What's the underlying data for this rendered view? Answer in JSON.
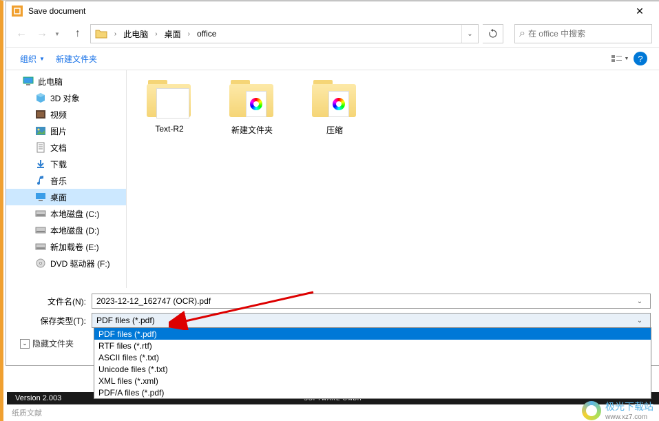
{
  "titlebar": {
    "title": "Save document"
  },
  "nav": {
    "path_segments": [
      "此电脑",
      "桌面",
      "office"
    ],
    "search_placeholder": "在 office 中搜索"
  },
  "toolbar": {
    "organize": "组织",
    "new_folder": "新建文件夹"
  },
  "sidebar": {
    "root": "此电脑",
    "items": [
      {
        "label": "3D 对象",
        "icon": "3d"
      },
      {
        "label": "视频",
        "icon": "video"
      },
      {
        "label": "图片",
        "icon": "pictures"
      },
      {
        "label": "文档",
        "icon": "docs"
      },
      {
        "label": "下载",
        "icon": "downloads"
      },
      {
        "label": "音乐",
        "icon": "music"
      },
      {
        "label": "桌面",
        "icon": "desktop",
        "selected": true
      },
      {
        "label": "本地磁盘 (C:)",
        "icon": "disk"
      },
      {
        "label": "本地磁盘 (D:)",
        "icon": "disk"
      },
      {
        "label": "新加载卷 (E:)",
        "icon": "disk"
      },
      {
        "label": "DVD 驱动器 (F:)",
        "icon": "dvd"
      }
    ]
  },
  "files": [
    {
      "label": "Text-R2",
      "type": "plain"
    },
    {
      "label": "新建文件夹",
      "type": "color"
    },
    {
      "label": "压缩",
      "type": "color"
    }
  ],
  "filename": {
    "label": "文件名(N):",
    "value": "2023-12-12_162747 (OCR).pdf"
  },
  "filetype": {
    "label": "保存类型(T):",
    "value": "PDF files (*.pdf)",
    "options": [
      "PDF files (*.pdf)",
      "RTF files (*.rtf)",
      "ASCII files (*.txt)",
      "Unicode files (*.txt)",
      "XML files (*.xml)",
      "PDF/A files (*.pdf)"
    ]
  },
  "hide_folders": "隐藏文件夹",
  "status": {
    "version": "Version 2.003",
    "center": "SOFTWARE GMBH"
  },
  "watermark": {
    "text": "极光下载站",
    "url": "www.xz7.com"
  },
  "bottom_text": "纸质文献"
}
